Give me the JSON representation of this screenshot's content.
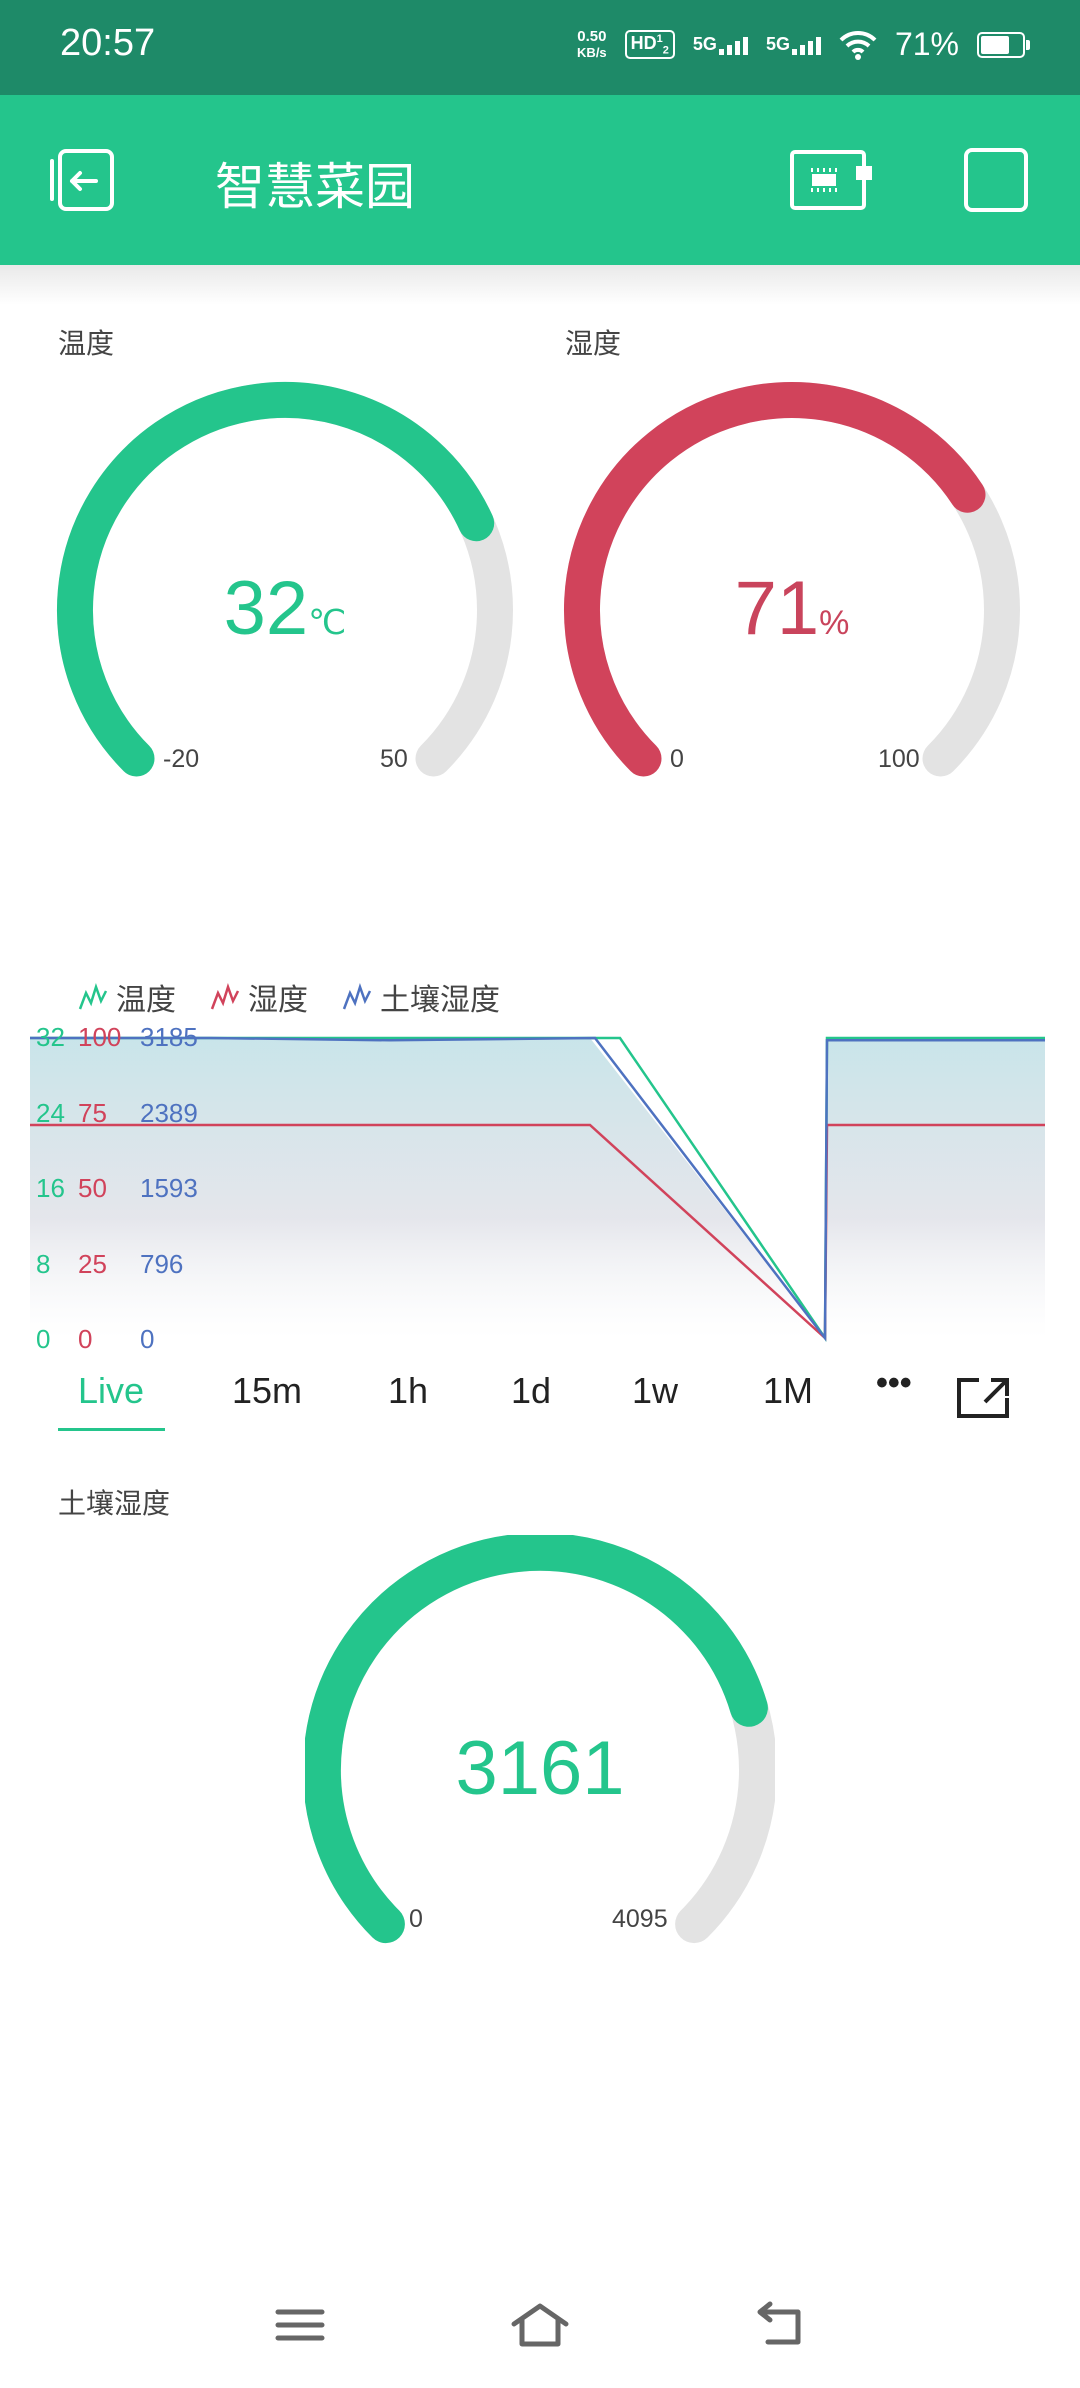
{
  "status_bar": {
    "time": "20:57",
    "net_speed_value": "0.50",
    "net_speed_unit": "KB/s",
    "hd_label": "HD",
    "hd_sup": "1",
    "hd_sub": "2",
    "sim1_label": "5G",
    "sim2_label": "5G",
    "battery_percent": "71%",
    "battery_level": 0.71
  },
  "app_bar": {
    "title": "智慧菜园",
    "back_icon": "exit-icon",
    "device_icon": "device-board-icon",
    "square_icon": "square-icon"
  },
  "temperature_gauge": {
    "label": "温度",
    "value": "32",
    "unit": "℃",
    "min": "-20",
    "max": "50",
    "value_num": 32,
    "min_num": -20,
    "max_num": 50,
    "color": "#24c58c"
  },
  "humidity_gauge": {
    "label": "湿度",
    "value": "71",
    "unit": "%",
    "min": "0",
    "max": "100",
    "value_num": 71,
    "min_num": 0,
    "max_num": 100,
    "color": "#d1435b"
  },
  "soil_gauge": {
    "label": "土壤湿度",
    "value": "3161",
    "unit": "",
    "min": "0",
    "max": "4095",
    "value_num": 3161,
    "min_num": 0,
    "max_num": 4095,
    "color": "#24c58c"
  },
  "chart_data": {
    "type": "area",
    "legend": [
      "温度",
      "湿度",
      "土壤湿度"
    ],
    "series": [
      {
        "name": "温度",
        "color": "#24c58c",
        "axis_ticks": [
          "32",
          "24",
          "16",
          "8",
          "0"
        ],
        "ylim": [
          0,
          32
        ],
        "values": [
          32,
          32,
          32,
          32,
          0,
          32,
          32
        ]
      },
      {
        "name": "湿度",
        "color": "#d1435b",
        "axis_ticks": [
          "100",
          "75",
          "50",
          "25",
          "0"
        ],
        "ylim": [
          0,
          100
        ],
        "values": [
          71,
          71,
          71,
          71,
          0,
          71,
          71
        ]
      },
      {
        "name": "土壤湿度",
        "color": "#4e72c0",
        "axis_ticks": [
          "3185",
          "2389",
          "1593",
          "796",
          "0"
        ],
        "ylim": [
          0,
          3185
        ],
        "values": [
          3185,
          3185,
          3161,
          3185,
          0,
          3161,
          3161
        ]
      }
    ]
  },
  "time_ranges": [
    "Live",
    "15m",
    "1h",
    "1d",
    "1w",
    "1M"
  ],
  "active_range": "Live",
  "more_label": "•••",
  "nav": {
    "menu_icon": "menu-icon",
    "home_icon": "home-icon",
    "back_icon": "back-icon"
  }
}
